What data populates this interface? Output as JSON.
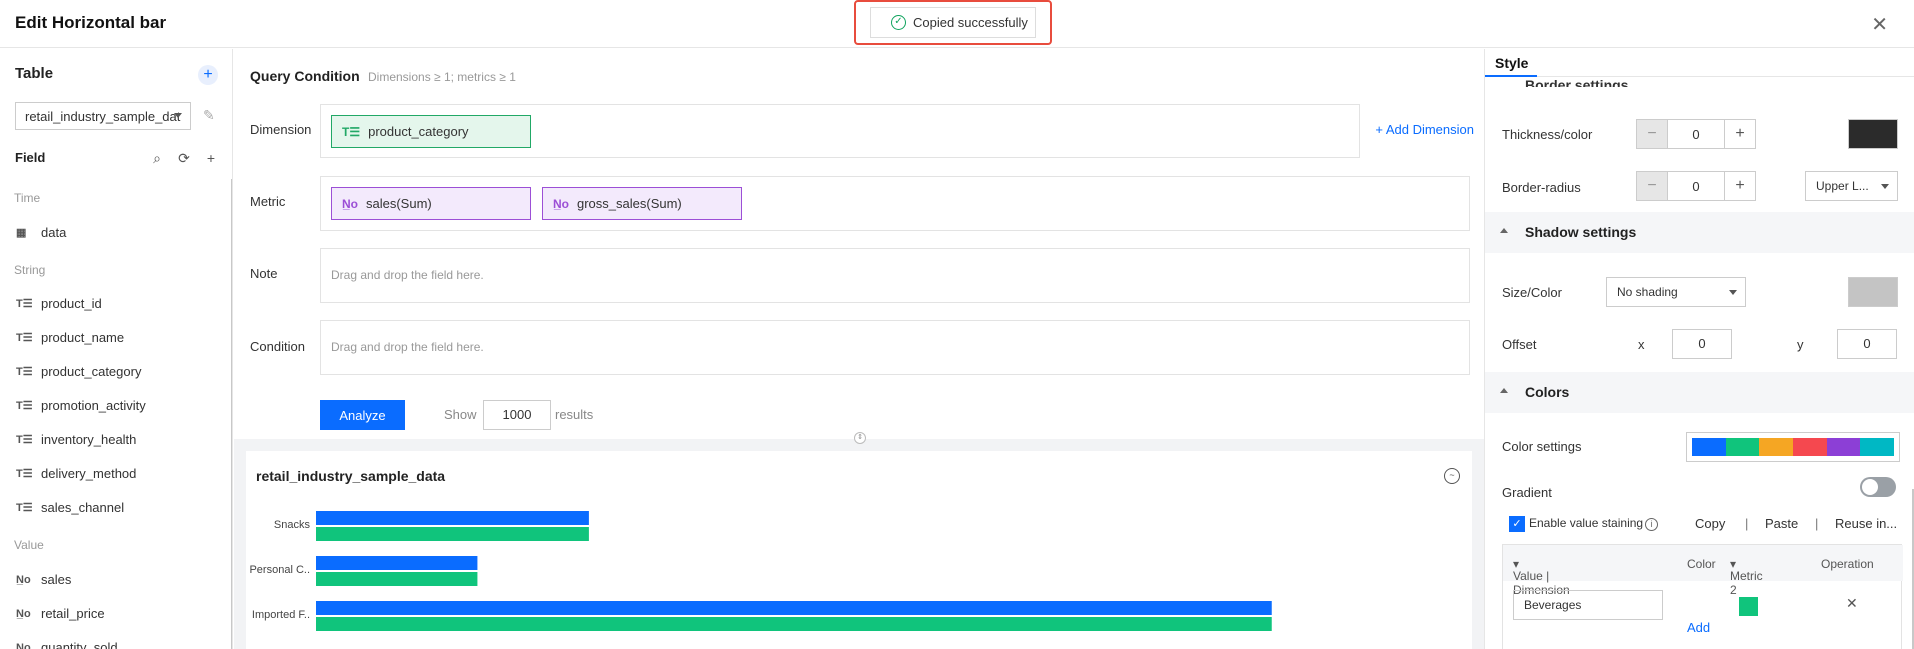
{
  "header": {
    "title": "Edit Horizontal bar",
    "toast": "Copied successfully"
  },
  "left": {
    "table_title": "Table",
    "table_select": "retail_industry_sample_dat",
    "field_title": "Field",
    "groups": {
      "time": "Time",
      "string": "String",
      "value": "Value"
    },
    "time_fields": [
      "data"
    ],
    "string_fields": [
      "product_id",
      "product_name",
      "product_category",
      "promotion_activity",
      "inventory_health",
      "delivery_method",
      "sales_channel"
    ],
    "value_fields": [
      "sales",
      "retail_price",
      "quantity_sold"
    ]
  },
  "query": {
    "title": "Query Condition",
    "subtitle": "Dimensions ≥ 1; metrics ≥ 1",
    "labels": {
      "dimension": "Dimension",
      "metric": "Metric",
      "note": "Note",
      "condition": "Condition"
    },
    "dimension_chip": "product_category",
    "metric_chips": [
      "sales(Sum)",
      "gross_sales(Sum)"
    ],
    "add_dimension": "+ Add Dimension",
    "drop_placeholder": "Drag and drop the field here.",
    "analyze": "Analyze",
    "show_label": "Show",
    "show_value": "1000",
    "results_label": "results"
  },
  "chart_data": {
    "type": "bar",
    "orientation": "horizontal",
    "title": "retail_industry_sample_data",
    "categories": [
      "Snacks",
      "Personal C..",
      "Imported F.."
    ],
    "series": [
      {
        "values": [
          235,
          139,
          823
        ],
        "color": "#0a6cff"
      },
      {
        "values": [
          235,
          139,
          823
        ],
        "color": "#10c47c"
      }
    ],
    "xlim": [
      0,
      930
    ]
  },
  "style": {
    "tab": "Style",
    "border_settings": "Border settings",
    "thickness_label": "Thickness/color",
    "thickness_value": "0",
    "border_color": "#2b2b2b",
    "radius_label": "Border-radius",
    "radius_value": "0",
    "radius_select": "Upper L...",
    "shadow_title": "Shadow settings",
    "size_color_label": "Size/Color",
    "shading_select": "No shading",
    "shadow_color": "#c4c4c4",
    "offset_label": "Offset",
    "x_label": "x",
    "x_value": "0",
    "y_label": "y",
    "y_value": "0",
    "colors_title": "Colors",
    "color_settings_label": "Color settings",
    "palette": [
      "#0a6cff",
      "#10c47c",
      "#f5a623",
      "#f5484f",
      "#8c3fd6",
      "#00b8c4"
    ],
    "gradient_label": "Gradient",
    "enable_staining": "Enable value staining",
    "copy": "Copy",
    "paste": "Paste",
    "reuse": "Reuse in...",
    "table_headers": {
      "value_dim": "Value | Dimension",
      "color": "Color",
      "metric": "Metric 2",
      "operation": "Operation"
    },
    "row_value": "Beverages",
    "row_color": "#10c47c",
    "add": "Add"
  }
}
